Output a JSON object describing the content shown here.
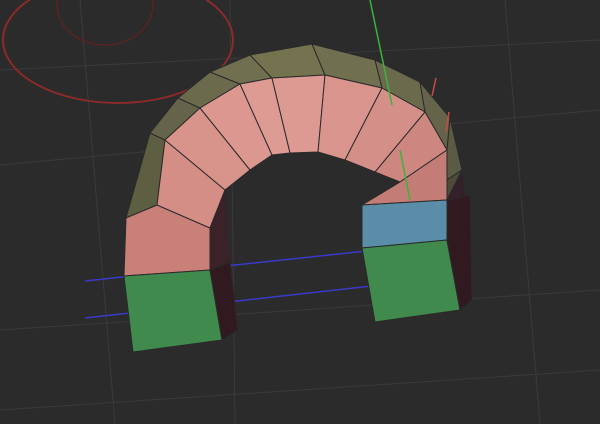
{
  "viewport": {
    "background": "#2b2b2b",
    "grid_color": "#3a3a3a"
  },
  "gizmo": {
    "rotation_ring_color": "#8a2a2a",
    "x_axis_color": "#c84a4a",
    "y_axis_color": "#3ab43a",
    "z_axis_color": "#3a3ac8"
  },
  "mesh": {
    "object": "arch",
    "outer_rim_color": "#6b6a4c",
    "front_face_color": "#d08a84",
    "inner_soffit_color": "#3a2228",
    "left_leg_front_color": "#3f8a4c",
    "left_leg_side_color": "#301a20",
    "right_leg_front_color": "#3f8a4c",
    "right_leg_top_color": "#5a8ea8",
    "right_leg_side_color": "#301a20",
    "edge_color": "#2a2a2a"
  }
}
